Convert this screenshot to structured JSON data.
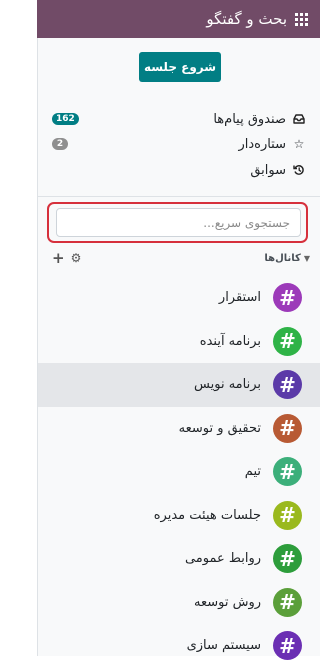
{
  "header": {
    "title": "بحث و گفتگو",
    "icon": "apps-grid-icon"
  },
  "start_meeting": {
    "label": "شروع جلسه"
  },
  "mailboxes": [
    {
      "label": "صندوق پیام‌ها",
      "icon": "inbox-icon",
      "counter": "162",
      "counter_color": "#017e84"
    },
    {
      "label": "ستاره‌دار",
      "icon": "star-icon",
      "counter": "2",
      "counter_color": "#8f8f8f"
    },
    {
      "label": "سوابق",
      "icon": "history-icon",
      "counter": ""
    }
  ],
  "search": {
    "placeholder": "جستجوی سریع...",
    "value": ""
  },
  "channels_header": {
    "title": "کانال‌ها"
  },
  "channels": [
    {
      "name": "استقرار",
      "color": "#9c3ab9",
      "active": false
    },
    {
      "name": "برنامه آینده",
      "color": "#2fb347",
      "active": false
    },
    {
      "name": "برنامه نویس",
      "color": "#5b3aa8",
      "active": true
    },
    {
      "name": "تحقیق و توسعه",
      "color": "#b85a34",
      "active": false
    },
    {
      "name": "تیم",
      "color": "#3caf7a",
      "active": false
    },
    {
      "name": "جلسات هیئت مدیره",
      "color": "#9ab91e",
      "active": false
    },
    {
      "name": "روابط عمومی",
      "color": "#2d9d3b",
      "active": false
    },
    {
      "name": "روش توسعه",
      "color": "#5b9f3a",
      "active": false
    },
    {
      "name": "سیستم سازی",
      "color": "#6b2fb3",
      "active": false
    }
  ],
  "hash_glyph": "#",
  "colors": {
    "brand": "#714b67",
    "primary": "#017e84",
    "highlight": "#d6303c"
  }
}
